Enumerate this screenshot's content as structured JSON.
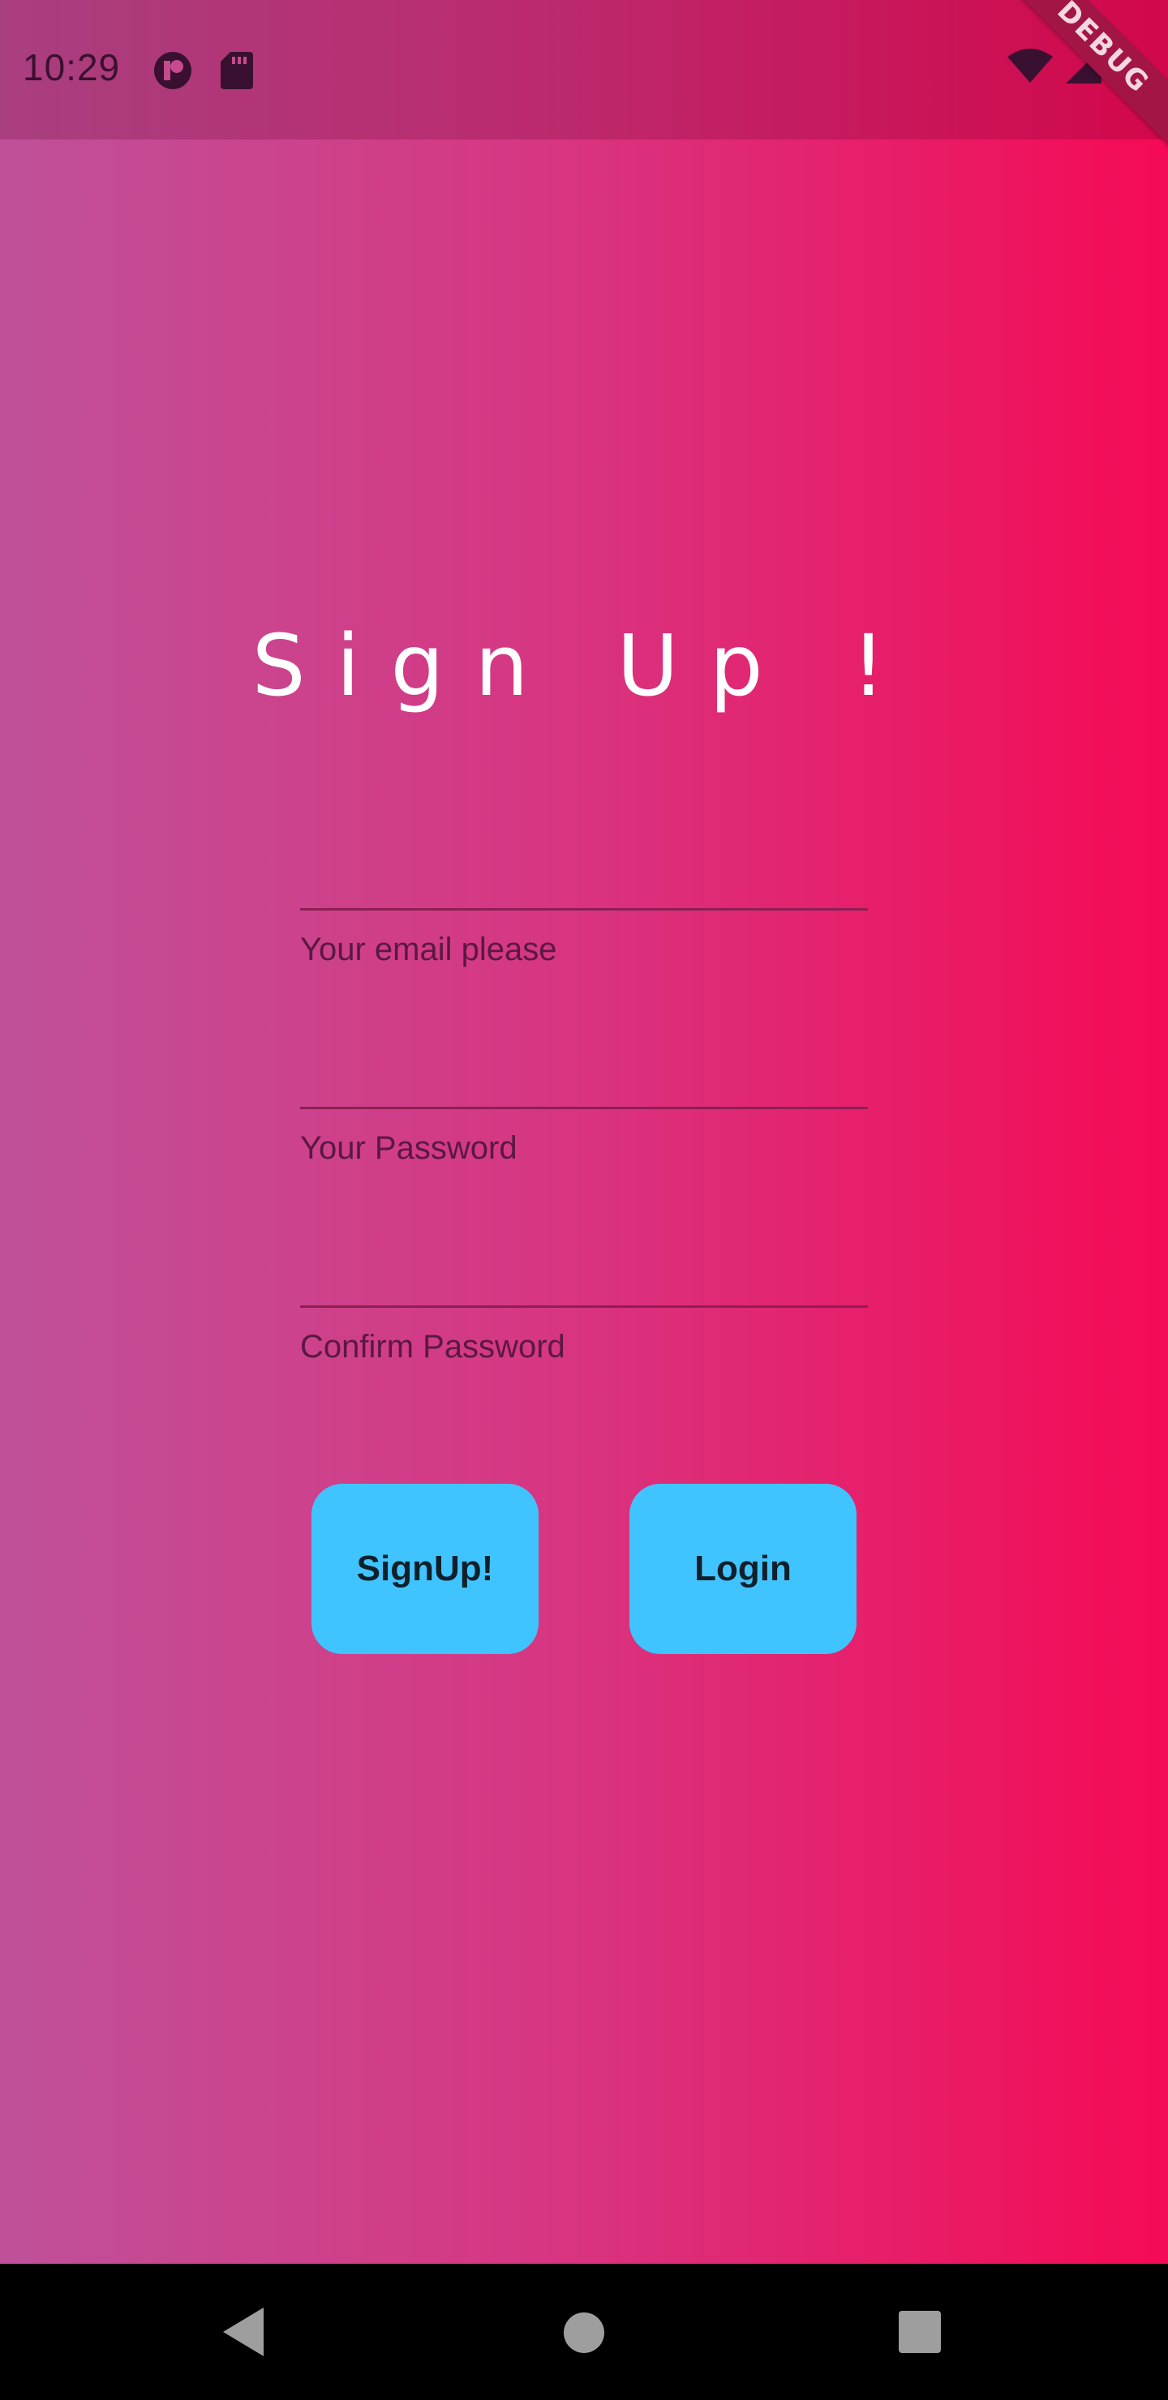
{
  "status_bar": {
    "time": "10:29",
    "left_icons": [
      "data-saver-icon",
      "sd-card-icon"
    ],
    "right_icons": [
      "wifi-icon",
      "signal-icon",
      "battery-icon"
    ],
    "debug_label": "DEBUG"
  },
  "screen": {
    "title": "Sign Up !"
  },
  "form": {
    "email": {
      "label": "Your email please",
      "value": ""
    },
    "password": {
      "label": "Your Password",
      "value": ""
    },
    "confirm_password": {
      "label": "Confirm Password",
      "value": ""
    }
  },
  "buttons": {
    "signup_label": "SignUp!",
    "login_label": "Login"
  },
  "colors": {
    "gradient_start": "#bf5198",
    "gradient_end": "#f50a55",
    "button": "#40c4ff",
    "title": "#ffffff"
  },
  "nav_bar": {
    "icons": [
      "back-icon",
      "home-icon",
      "recents-icon"
    ]
  }
}
